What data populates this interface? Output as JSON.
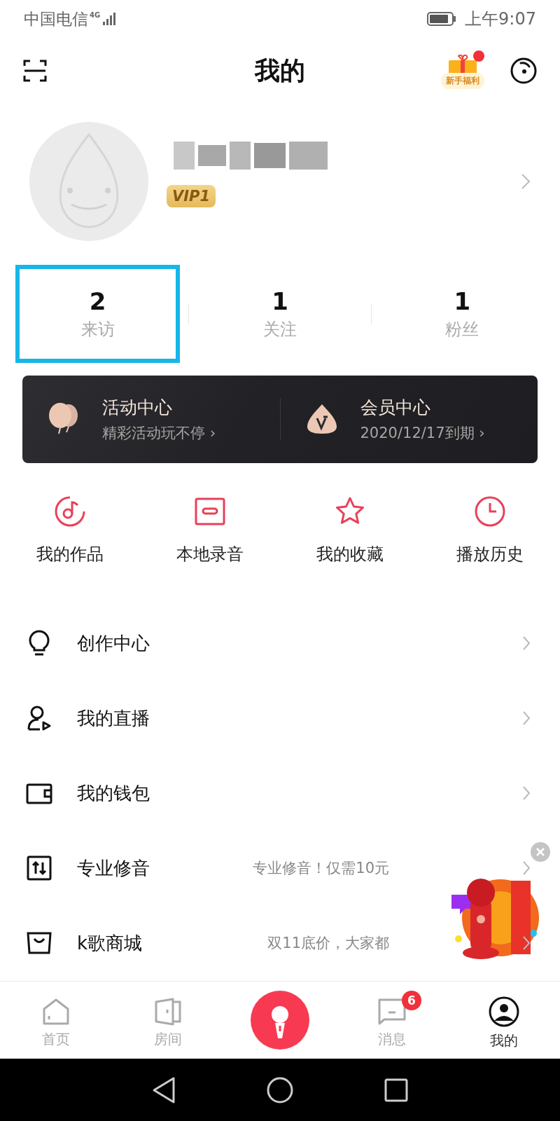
{
  "status_bar": {
    "carrier": "中国电信",
    "network": "4G",
    "time": "上午9:07"
  },
  "header": {
    "title": "我的",
    "gift_label": "新手福利",
    "gift_dot": true
  },
  "profile": {
    "vip": "VIP1"
  },
  "stats": [
    {
      "value": "2",
      "label": "来访",
      "highlighted": true
    },
    {
      "value": "1",
      "label": "关注",
      "highlighted": false
    },
    {
      "value": "1",
      "label": "粉丝",
      "highlighted": false
    }
  ],
  "banner": [
    {
      "kind": "balloon",
      "title": "活动中心",
      "subtitle": "精彩活动玩不停 ›"
    },
    {
      "kind": "vip",
      "title": "会员中心",
      "subtitle": "2020/12/17到期 ›"
    }
  ],
  "shortcuts": [
    {
      "kind": "music",
      "label": "我的作品"
    },
    {
      "kind": "tape",
      "label": "本地录音"
    },
    {
      "kind": "star",
      "label": "我的收藏"
    },
    {
      "kind": "clock",
      "label": "播放历史"
    }
  ],
  "menu": [
    {
      "kind": "bulb",
      "label": "创作中心"
    },
    {
      "kind": "live",
      "label": "我的直播"
    },
    {
      "kind": "wallet",
      "label": "我的钱包"
    },
    {
      "kind": "tune",
      "label": "专业修音",
      "hint": "专业修音！仅需10元"
    },
    {
      "kind": "bag",
      "label": "k歌商城",
      "hint": "双11底价，大家都"
    }
  ],
  "tabs": [
    {
      "kind": "home",
      "label": "首页",
      "selected": false
    },
    {
      "kind": "room",
      "label": "房间",
      "selected": false
    },
    {
      "kind": "mic",
      "selected": false
    },
    {
      "kind": "message",
      "label": "消息",
      "selected": false,
      "badge": "6"
    },
    {
      "kind": "me",
      "label": "我的",
      "selected": true
    }
  ]
}
